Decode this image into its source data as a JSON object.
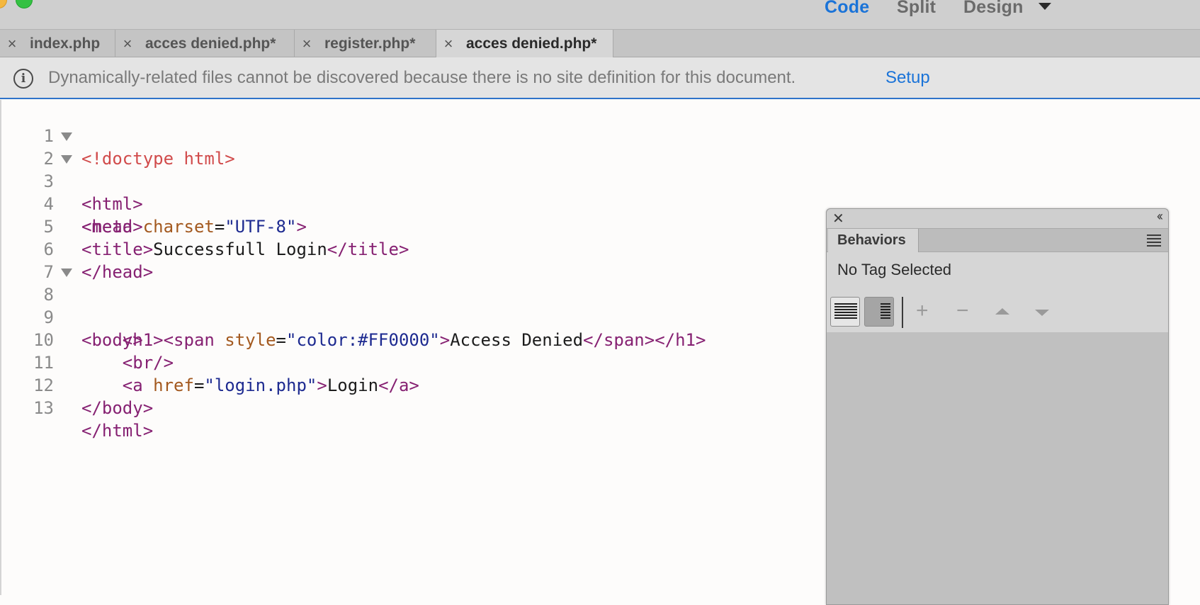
{
  "toolbar": {
    "view_code": "Code",
    "view_split": "Split",
    "view_design": "Design",
    "active_view": "Code"
  },
  "tabs": [
    {
      "label": "index.php",
      "active": false
    },
    {
      "label": "acces denied.php*",
      "active": false
    },
    {
      "label": "register.php*",
      "active": false
    },
    {
      "label": "acces denied.php*",
      "active": true
    }
  ],
  "infobar": {
    "message": "Dynamically-related files cannot be discovered because there is no site definition for this document.",
    "link": "Setup"
  },
  "editor": {
    "lines": [
      {
        "n": "1"
      },
      {
        "n": "2"
      },
      {
        "n": "3"
      },
      {
        "n": "4"
      },
      {
        "n": "5"
      },
      {
        "n": "6"
      },
      {
        "n": "7"
      },
      {
        "n": "8"
      },
      {
        "n": "9"
      },
      {
        "n": "10"
      },
      {
        "n": "11"
      },
      {
        "n": "12"
      },
      {
        "n": "13"
      }
    ],
    "code": {
      "l1": "<!doctype html>",
      "l2": "<html>",
      "l3": "<head>",
      "l4_open": "<meta ",
      "l4_attr": "charset",
      "l4_eq": "=",
      "l4_val": "\"UTF-8\"",
      "l4_close": ">",
      "l5_open": "<title>",
      "l5_text": "Successfull Login",
      "l5_close": "</title>",
      "l6": "</head>",
      "l8": "<body>",
      "l9_indent": "    ",
      "l9_open": "<h1><span ",
      "l9_attr": "style",
      "l9_eq": "=",
      "l9_val": "\"color:#FF0000\"",
      "l9_gt": ">",
      "l9_text": "Access Denied",
      "l9_close": "</span></h1>",
      "l10_indent": "    ",
      "l10": "<br/>",
      "l11_indent": "    ",
      "l11_open": "<a ",
      "l11_attr": "href",
      "l11_eq": "=",
      "l11_val": "\"login.php\"",
      "l11_gt": ">",
      "l11_text": "Login",
      "l11_close": "</a>",
      "l12": "</body>",
      "l13": "</html>"
    }
  },
  "panel": {
    "tab_label": "Behaviors",
    "status": "No Tag Selected",
    "close_glyph": "✕",
    "collapse_glyph": "‹‹",
    "add_glyph": "+",
    "remove_glyph": "−"
  },
  "colors": {
    "accent": "#1a73d8",
    "tag": "#862172",
    "attr": "#a3591f",
    "value": "#1d2a90",
    "doctype": "#d14b4b"
  }
}
